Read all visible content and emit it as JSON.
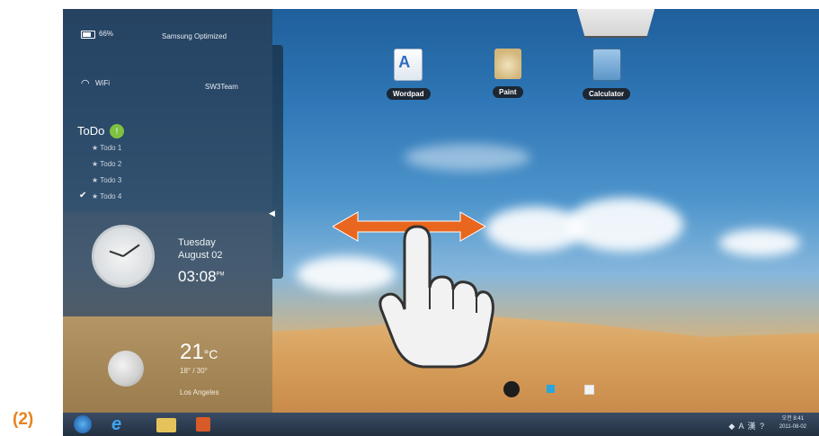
{
  "figure_label": "(2)",
  "panel": {
    "battery_text": "66%",
    "profile_text": "Samsung Optimized",
    "wifi_text": "WiFi",
    "network_name": "SW3Team",
    "todo": {
      "title": "ToDo",
      "badge": "!",
      "items": [
        "Todo 1",
        "Todo 2",
        "Todo 3",
        "Todo 4"
      ],
      "checked_index": 3
    },
    "clock": {
      "day": "Tuesday",
      "date": "August 02",
      "time": "03:08",
      "ampm": "PM"
    },
    "weather": {
      "temperature": "21",
      "unit": "°C",
      "range": "18° / 30°",
      "city": "Los Angeles"
    }
  },
  "desktop": {
    "icons": [
      {
        "label": "Wordpad",
        "icon": "wordpad-icon"
      },
      {
        "label": "Paint",
        "icon": "paint-icon"
      },
      {
        "label": "Calculator",
        "icon": "calculator-icon"
      }
    ]
  },
  "taskbar": {
    "tray_text": "◆ A 漢 ?",
    "clock_time": "오전 8:41",
    "clock_date": "2011-08-02",
    "buttons": [
      "start-orb-icon",
      "internet-explorer-icon",
      "folder-icon",
      "media-player-icon"
    ]
  },
  "gesture": {
    "description_icon": "swipe-horizontal-hand-icon",
    "arrow_color": "#e8661e"
  }
}
